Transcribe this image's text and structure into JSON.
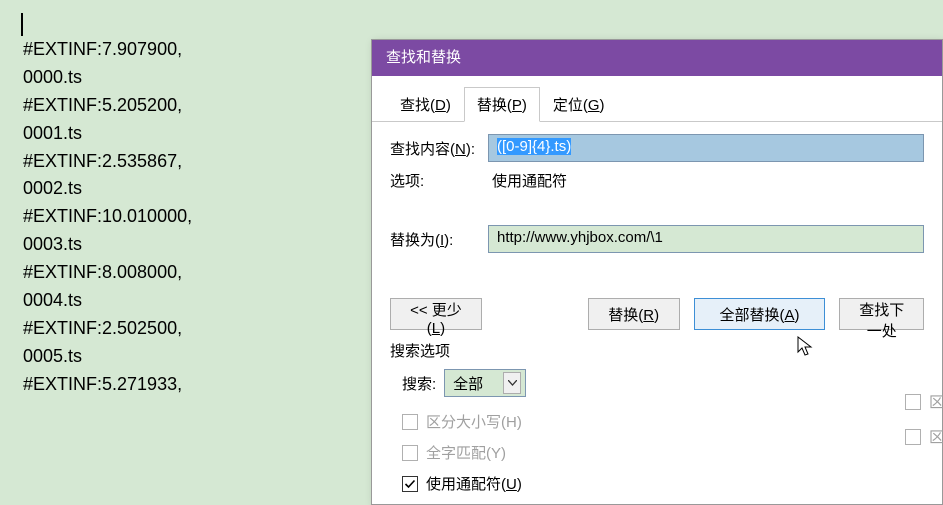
{
  "editor": {
    "lines": [
      "#EXTINF:7.907900,",
      "0000.ts",
      "#EXTINF:5.205200,",
      "0001.ts",
      "#EXTINF:2.535867,",
      "0002.ts",
      "#EXTINF:10.010000,",
      "0003.ts",
      "#EXTINF:8.008000,",
      "0004.ts",
      "#EXTINF:2.502500,",
      "0005.ts",
      "#EXTINF:5.271933,"
    ]
  },
  "dialog": {
    "title": "查找和替换",
    "tabs": {
      "find": {
        "label": "查找(",
        "accel": "D",
        "tail": ")"
      },
      "replace": {
        "label": "替换(",
        "accel": "P",
        "tail": ")"
      },
      "goto": {
        "label": "定位(",
        "accel": "G",
        "tail": ")"
      }
    },
    "find_label": {
      "label": "查找内容(",
      "accel": "N",
      "tail": "):"
    },
    "find_value": "([0-9]{4}.ts)",
    "options_label": "选项:",
    "options_value": "使用通配符",
    "replace_label": {
      "label": "替换为(",
      "accel": "I",
      "tail": "):"
    },
    "replace_value": "http://www.yhjbox.com/\\1",
    "buttons": {
      "less": {
        "label": "<< 更少(",
        "accel": "L",
        "tail": ")"
      },
      "replace": {
        "label": "替换(",
        "accel": "R",
        "tail": ")"
      },
      "replace_all": {
        "label": "全部替换(",
        "accel": "A",
        "tail": ")"
      },
      "find_next": "查找下一处"
    },
    "search_options_label": "搜索选项",
    "search_label": "搜索:",
    "search_scope": "全部",
    "checkboxes": {
      "match_case": "区分大小写(H)",
      "whole_word": "全字匹配(Y)",
      "wildcards": {
        "label": "使用通配符(",
        "accel": "U",
        "tail": ")"
      },
      "right1": "区",
      "right2": "区"
    }
  }
}
